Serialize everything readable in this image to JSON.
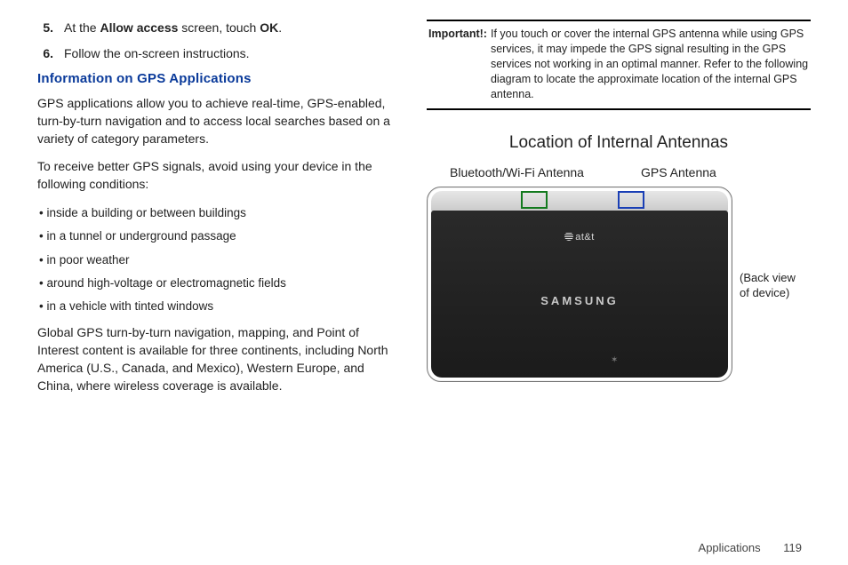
{
  "left": {
    "step5_num": "5.",
    "step5_pre": "At the ",
    "step5_bold1": "Allow access",
    "step5_mid": " screen, touch ",
    "step5_bold2": "OK",
    "step5_end": ".",
    "step6_num": "6.",
    "step6_body": "Follow the on-screen instructions.",
    "heading": "Information on GPS Applications",
    "para1": "GPS applications allow you to achieve real-time, GPS-enabled, turn-by-turn navigation and to access local searches based on a variety of category parameters.",
    "para2": "To receive better GPS signals, avoid using your device in the following conditions:",
    "bullets": [
      " inside a building or between buildings",
      "in a tunnel or underground passage",
      "in poor weather",
      "around high-voltage or electromagnetic fields",
      "in a vehicle with tinted windows"
    ],
    "para3": "Global GPS turn-by-turn navigation, mapping, and Point of Interest content is available for three continents, including North America (U.S., Canada, and Mexico), Western Europe, and China, where wireless coverage is available."
  },
  "right": {
    "important_label": "Important!:",
    "important_body": "If you touch or cover the internal GPS antenna while using GPS services, it may impede the GPS signal resulting in the GPS services not working in an optimal manner. Refer to the following diagram to locate the approximate location of the internal GPS antenna.",
    "diagram_title": "Location of Internal Antennas",
    "label_bt": "Bluetooth/Wi-Fi Antenna",
    "label_gps": "GPS Antenna",
    "carrier": "at&t",
    "brand": "SAMSUNG",
    "backview_l1": "(Back view",
    "backview_l2": "of device)"
  },
  "footer": {
    "section": "Applications",
    "page": "119"
  }
}
